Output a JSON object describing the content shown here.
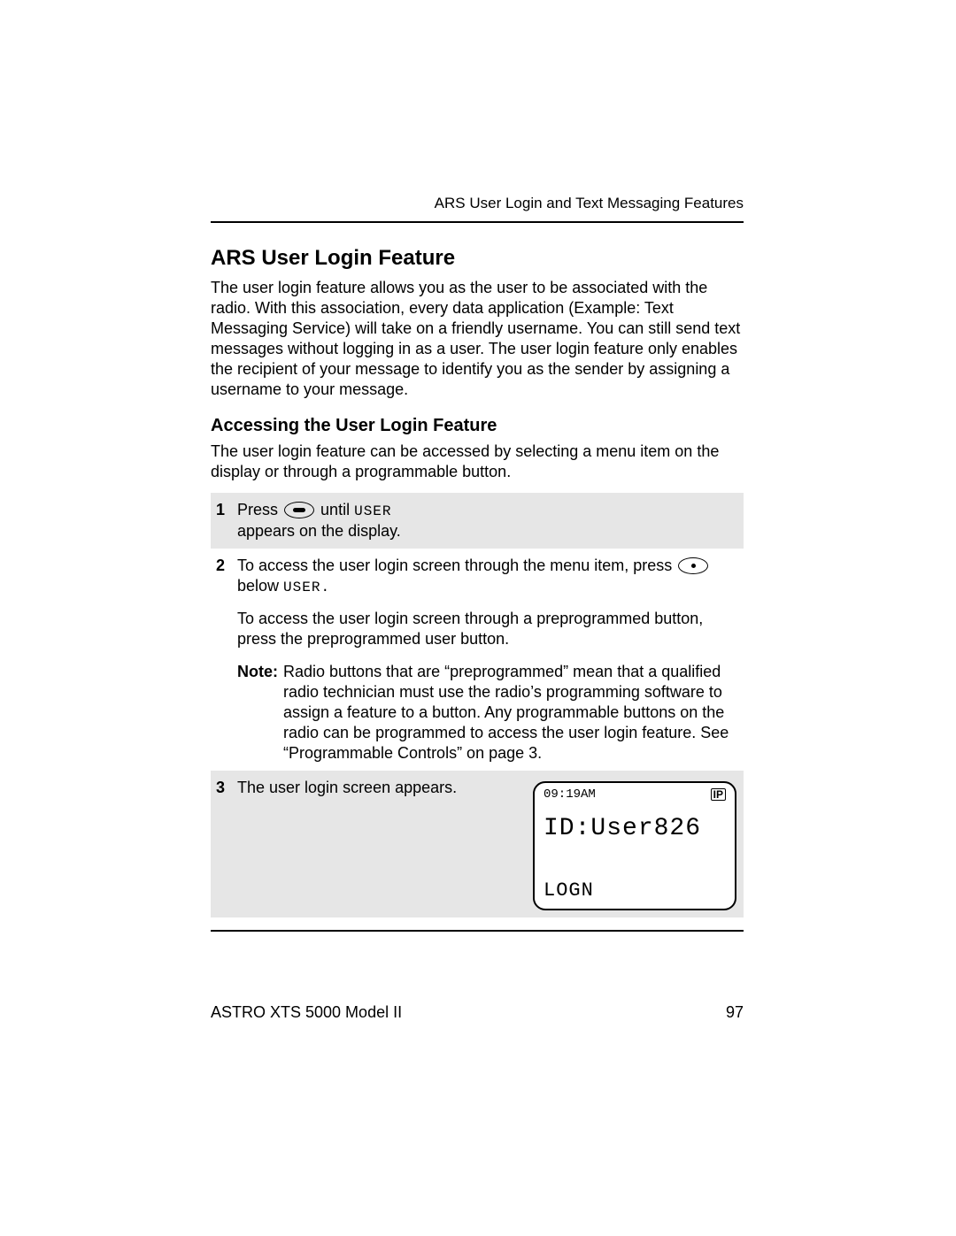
{
  "header": {
    "chapter_label": "ARS User Login and Text Messaging Features"
  },
  "section": {
    "heading": "ARS User Login Feature",
    "intro": "The user login feature allows you as the user to be associated with the radio. With this association, every data application (Example: Text Messaging Service) will take on a friendly username. You can still send text messages without logging in as a user. The user login feature only enables the recipient of your message to identify you as the sender by assigning a username to your message."
  },
  "subsection": {
    "heading": "Accessing the User Login Feature",
    "intro": "The user login feature can be accessed by selecting a menu item on the display or through a programmable button."
  },
  "steps": {
    "s1": {
      "num": "1",
      "pre": "Press",
      "mid": "until",
      "code": "USER",
      "post": "appears on the display."
    },
    "s2": {
      "num": "2",
      "pre": "To access the user login screen through the menu item, press",
      "mid": "below",
      "code": "USER.",
      "para2": "To access the user login screen through a preprogrammed button, press the preprogrammed user button.",
      "note_label": "Note:",
      "note_text": "Radio buttons that are “preprogrammed” mean that a qualified radio technician must use the radio’s programming software to assign a feature to a button. Any programmable buttons on the radio can be programmed to access the user login feature. See “Programmable Controls” on page 3."
    },
    "s3": {
      "num": "3",
      "text": "The user login screen appears.",
      "display": {
        "time": "09:19AM",
        "ip": "IP",
        "id": "ID:User826",
        "menu": "LOGN"
      }
    }
  },
  "footer": {
    "model": "ASTRO XTS 5000 Model II",
    "page": "97"
  }
}
